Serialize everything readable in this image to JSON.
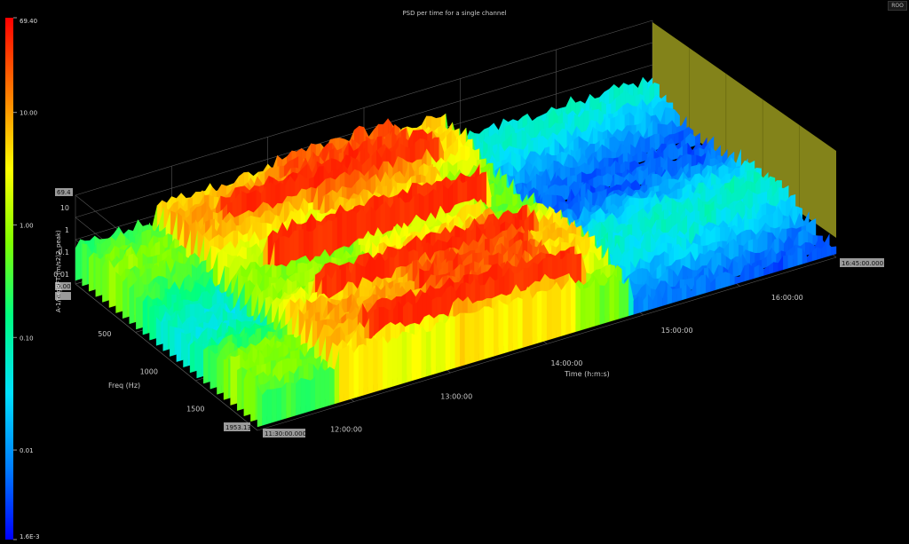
{
  "chart_data": {
    "type": "heatmap",
    "title": "PSD per time for a single channel",
    "xlabel": "Time (h:m:s)",
    "ylabel": "Freq (Hz)",
    "zlabel": "A-1/nxgRFT (m/s2)2_peak)",
    "log_z": true,
    "x_ticks": [
      "12:00:00",
      "13:00:00",
      "14:00:00",
      "15:00:00",
      "16:00:00"
    ],
    "x_range_labels": [
      "11:30:00.000",
      "16:45:00.000"
    ],
    "y_ticks": [
      "500",
      "1000",
      "1500"
    ],
    "y_max_label": "1953.13",
    "z_ticks": [
      "10",
      "1",
      "0.1",
      "0.01",
      "0.00",
      "0"
    ],
    "z_max_label": "69.4",
    "colorbar_ticks": [
      "69.40",
      "10.00",
      "1.00",
      "0.10",
      "0.01",
      "1.6E-3"
    ],
    "colorbar_range": [
      0.0016,
      69.4
    ],
    "colormap": [
      "#0000ff",
      "#0080ff",
      "#00e0ff",
      "#00ff80",
      "#80ff00",
      "#ffff00",
      "#ff8000",
      "#ff0000"
    ],
    "time_range_hours": [
      11.5,
      16.75
    ],
    "freq_range_hz": [
      0,
      1953.13
    ],
    "grid": true,
    "surface_segments": [
      {
        "t_start": 11.5,
        "t_end": 12.2,
        "level": 0.45
      },
      {
        "t_start": 12.2,
        "t_end": 13.3,
        "level": 0.7
      },
      {
        "t_start": 13.3,
        "t_end": 14.4,
        "level": 0.8
      },
      {
        "t_start": 14.4,
        "t_end": 14.9,
        "level": 0.65
      },
      {
        "t_start": 14.9,
        "t_end": 16.75,
        "level": 0.22
      }
    ]
  },
  "ui": {
    "corner_button_label": "ROO"
  },
  "colors": {
    "background": "#000000",
    "grid": "#555555",
    "back_wall": "#9a9a1e",
    "label": "#c8c8c8",
    "tick_box": "#9a9a9a"
  }
}
